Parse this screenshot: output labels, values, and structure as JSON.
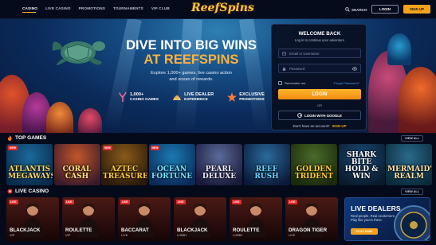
{
  "header": {
    "nav": [
      {
        "label": "CASINO",
        "active": true
      },
      {
        "label": "LIVE CASINO"
      },
      {
        "label": "PROMOTIONS"
      },
      {
        "label": "TOURNAMENTS"
      },
      {
        "label": "VIP CLUB"
      }
    ],
    "logo": "ReefSpins",
    "search_label": "SEARCH",
    "login_label": "LOGIN",
    "signup_label": "SIGN UP"
  },
  "hero": {
    "title_line1": "DIVE INTO BIG WINS",
    "title_line2": "AT REEFSPINS",
    "subtitle_line1": "Explore 1,000+ games, live casino action",
    "subtitle_line2": "and ocean of rewards.",
    "features": [
      {
        "line1": "1,000+",
        "line2": "CASINO GAMES",
        "icon": "coral-icon"
      },
      {
        "line1": "LIVE DEALER",
        "line2": "EXPERIENCE",
        "icon": "shell-icon"
      },
      {
        "line1": "EXCLUSIVE",
        "line2": "PROMOTIONS",
        "icon": "starfish-icon"
      }
    ]
  },
  "login_card": {
    "title": "WELCOME BACK",
    "subtitle": "Log in to continue your adventure",
    "email_placeholder": "Email or Username",
    "password_placeholder": "Password",
    "remember_label": "Remember me",
    "forgot_label": "Forgot Password?",
    "login_button": "LOGIN",
    "or_label": "OR",
    "google_button": "LOGIN WITH GOOGLE",
    "no_account": "Don't have an account?",
    "signup_link": "SIGN UP"
  },
  "top_games": {
    "title": "TOP GAMES",
    "view_all": "VIEW ALL",
    "games": [
      {
        "name": "ATLANTIS MEGAWAYS",
        "badge": "NEW",
        "bg1": "#1a6a9a",
        "bg2": "#0a2a4a",
        "fg": "#ffd65a"
      },
      {
        "name": "CORAL CASH",
        "badge": "",
        "bg1": "#c2562a",
        "bg2": "#3a1a2a",
        "fg": "#ffe27a"
      },
      {
        "name": "AZTEC TREASURE",
        "badge": "NEW",
        "bg1": "#8a5a1a",
        "bg2": "#2a1a0a",
        "fg": "#ffcc3a"
      },
      {
        "name": "OCEAN FORTUNE",
        "badge": "NEW",
        "bg1": "#1a7ab0",
        "bg2": "#0a2a5a",
        "fg": "#7ae0ff"
      },
      {
        "name": "PEARL DELUXE",
        "badge": "",
        "bg1": "#5a6a9a",
        "bg2": "#1a1a3a",
        "fg": "#f0e8ff"
      },
      {
        "name": "REEF RUSH",
        "badge": "",
        "bg1": "#2a6a9a",
        "bg2": "#0a1a3a",
        "fg": "#6ad0ff"
      },
      {
        "name": "GOLDEN TRIDENT",
        "badge": "",
        "bg1": "#4a6a2a",
        "bg2": "#1a2a0a",
        "fg": "#ffcc2a"
      },
      {
        "name": "SHARK BITE HOLD & WIN",
        "badge": "",
        "bg1": "#1a4a7a",
        "bg2": "#0a1a2a",
        "fg": "#ffffff"
      },
      {
        "name": "MERMAID'S REALM",
        "badge": "",
        "bg1": "#2a6a8a",
        "bg2": "#0a2a3a",
        "fg": "#ffe0a0"
      }
    ]
  },
  "live_casino": {
    "title": "LIVE CASINO",
    "view_all": "VIEW ALL",
    "tables": [
      {
        "name": "BLACKJACK",
        "sub": "VIP",
        "badge": "LIVE"
      },
      {
        "name": "ROULETTE",
        "sub": "VIP",
        "badge": "LIVE"
      },
      {
        "name": "BACCARAT",
        "sub": "LIVE",
        "badge": "LIVE"
      },
      {
        "name": "BLACKJACK",
        "sub": "LOBBY",
        "badge": "LIVE"
      },
      {
        "name": "ROULETTE",
        "sub": "LOBBY",
        "badge": "LIVE"
      },
      {
        "name": "DRAGON TIGER",
        "sub": "LIVE",
        "badge": "LIVE"
      }
    ],
    "promo": {
      "title": "LIVE DEALERS",
      "line1": "Real people. Real excitement.",
      "line2": "Play like you're there.",
      "button": "PLAY NOW"
    }
  },
  "colors": {
    "accent": "#f5a21d",
    "background": "#050a1a",
    "live_badge": "#e32a2a",
    "link": "#4a9cff"
  }
}
